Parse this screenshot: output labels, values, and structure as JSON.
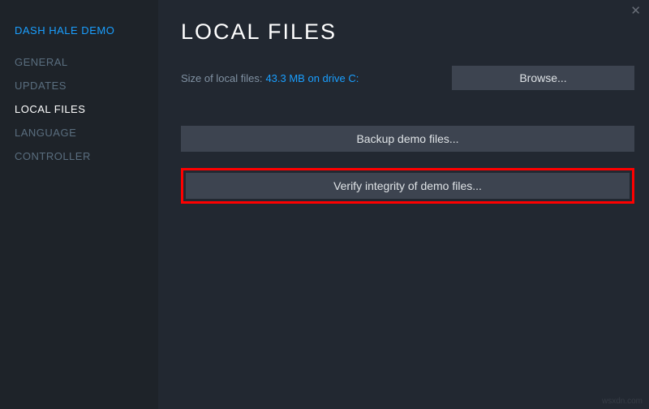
{
  "gameTitle": "DASH HALE DEMO",
  "sidebar": {
    "items": [
      {
        "label": "GENERAL"
      },
      {
        "label": "UPDATES"
      },
      {
        "label": "LOCAL FILES"
      },
      {
        "label": "LANGUAGE"
      },
      {
        "label": "CONTROLLER"
      }
    ]
  },
  "main": {
    "title": "LOCAL FILES",
    "sizeLabel": "Size of local files:",
    "sizeValue": "43.3 MB on drive C:",
    "browseLabel": "Browse...",
    "backupLabel": "Backup demo files...",
    "verifyLabel": "Verify integrity of demo files..."
  },
  "closeGlyph": "✕",
  "watermark": "wsxdn.com"
}
